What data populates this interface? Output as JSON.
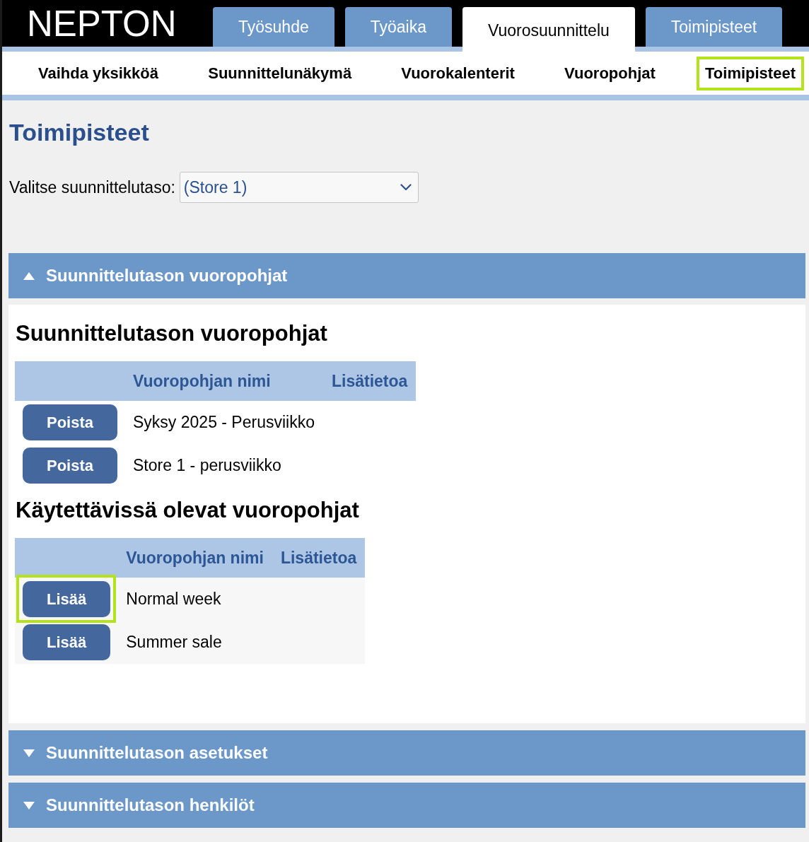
{
  "header": {
    "logo": "NEPTON",
    "tabs": [
      {
        "label": "Työsuhde",
        "selected": false
      },
      {
        "label": "Työaika",
        "selected": false
      },
      {
        "label": "Vuorosuunnittelu",
        "selected": true
      },
      {
        "label": "Toimipisteet",
        "selected": false
      }
    ]
  },
  "subnav": [
    {
      "label": "Vaihda yksikköä",
      "highlighted": false
    },
    {
      "label": "Suunnittelunäkymä",
      "highlighted": false
    },
    {
      "label": "Vuorokalenterit",
      "highlighted": false
    },
    {
      "label": "Vuoropohjat",
      "highlighted": false
    },
    {
      "label": "Toimipisteet",
      "highlighted": true
    }
  ],
  "page_title": "Toimipisteet",
  "level_select": {
    "label": "Valitse suunnittelutaso:",
    "value": "(Store 1)"
  },
  "sections": [
    {
      "title": "Suunnittelutason vuoropohjat",
      "expanded": true,
      "tables": [
        {
          "kind": "assigned",
          "heading": "Suunnittelutason vuoropohjat",
          "columns": [
            "Vuoropohjan nimi",
            "Lisätietoa"
          ],
          "rows": [
            {
              "button": {
                "label": "Poista",
                "highlighted": false
              },
              "name": "Syksy 2025 - Perusviikko"
            },
            {
              "button": {
                "label": "Poista",
                "highlighted": false
              },
              "name": "Store 1 - perusviikko"
            }
          ]
        },
        {
          "kind": "available",
          "heading": "Käytettävissä olevat vuoropohjat",
          "columns": [
            "Vuoropohjan nimi",
            "Lisätietoa"
          ],
          "rows": [
            {
              "button": {
                "label": "Lisää",
                "highlighted": true
              },
              "name": "Normal week"
            },
            {
              "button": {
                "label": "Lisää",
                "highlighted": false
              },
              "name": "Summer sale"
            }
          ]
        }
      ]
    },
    {
      "title": "Suunnittelutason asetukset",
      "expanded": false
    },
    {
      "title": "Suunnittelutason henkilöt",
      "expanded": false
    }
  ]
}
